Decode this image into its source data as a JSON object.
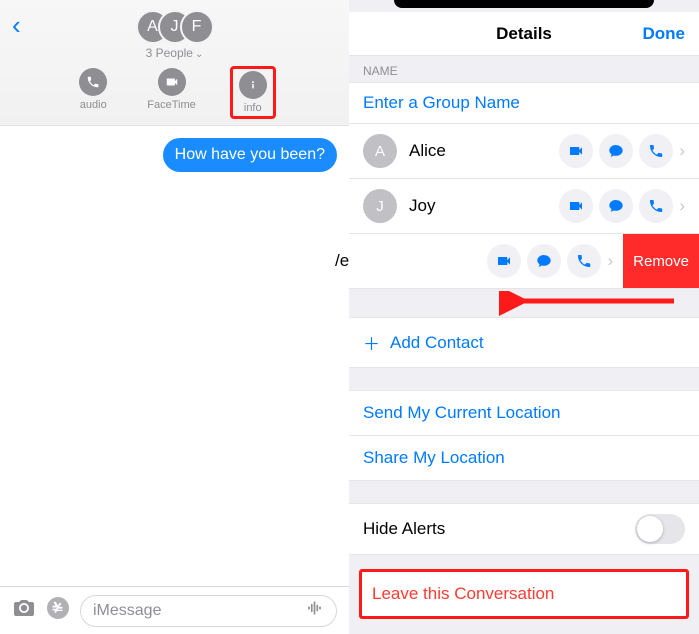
{
  "left": {
    "avatars": [
      "A",
      "J",
      "F"
    ],
    "people": "3 People",
    "actions": {
      "audio": "audio",
      "facetime": "FaceTime",
      "info": "info"
    },
    "message": "How have you been?",
    "compose_placeholder": "iMessage"
  },
  "right": {
    "title": "Details",
    "done": "Done",
    "name_label": "NAME",
    "group_placeholder": "Enter a Group Name",
    "members": [
      {
        "initial": "A",
        "name": "Alice"
      },
      {
        "initial": "J",
        "name": "Joy"
      }
    ],
    "swiped": {
      "name_fragment": "/e",
      "remove": "Remove"
    },
    "add_contact": "Add Contact",
    "send_loc": "Send My Current Location",
    "share_loc": "Share My Location",
    "hide_alerts": "Hide Alerts",
    "leave": "Leave this Conversation"
  }
}
